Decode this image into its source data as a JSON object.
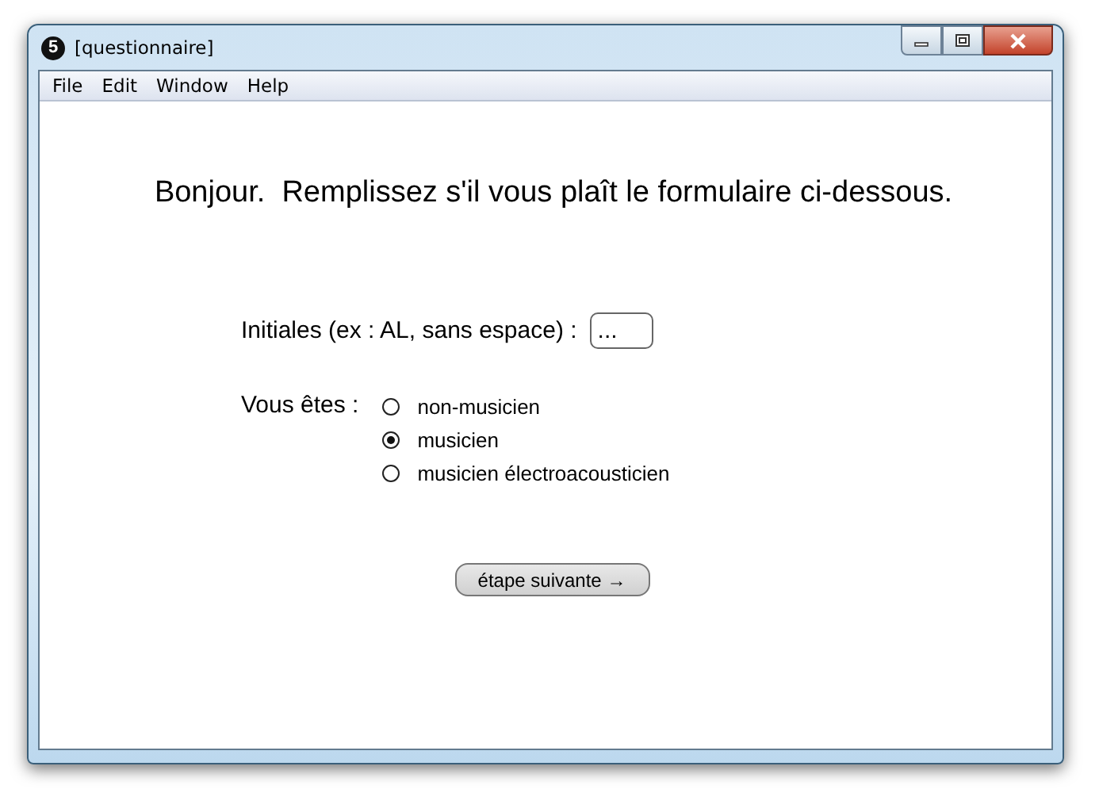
{
  "window": {
    "app_icon": "5",
    "title": "[questionnaire]"
  },
  "menu": [
    "File",
    "Edit",
    "Window",
    "Help"
  ],
  "heading": "Bonjour.  Remplissez s'il vous plaît le formulaire ci-dessous.",
  "initials": {
    "label": "Initiales (ex : AL, sans espace) :",
    "value": "..."
  },
  "profile": {
    "label": "Vous êtes :",
    "options": [
      {
        "label": "non-musicien",
        "selected": false
      },
      {
        "label": "musicien",
        "selected": true
      },
      {
        "label": "musicien électroacousticien",
        "selected": false
      }
    ]
  },
  "next_button": "étape suivante →"
}
